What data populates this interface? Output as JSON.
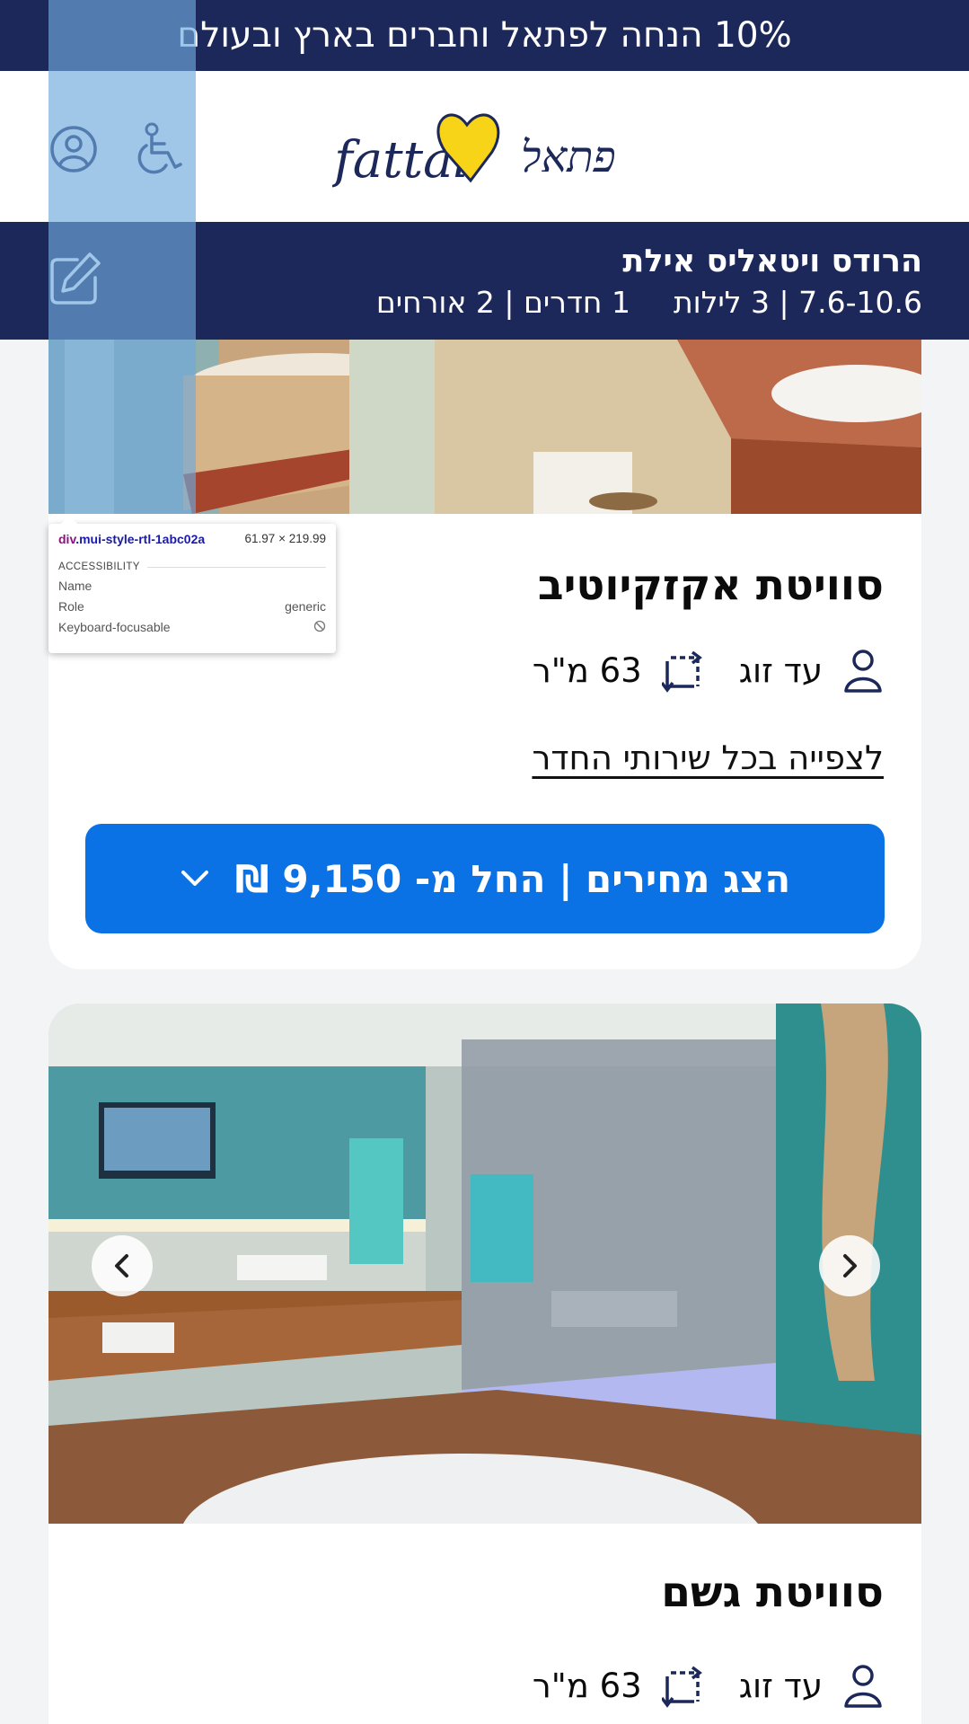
{
  "promo": {
    "text": "10% הנחה לפתאל וחברים בארץ ובעולם"
  },
  "header": {
    "logo_text_latin": "fattal",
    "logo_text_hebrew": "פתאל"
  },
  "search": {
    "hotel_name": "הרודס ויטאליס אילת",
    "dates_nights": "7.6-10.6 | 3 לילות",
    "rooms_guests": "1 חדרים | 2 אורחים"
  },
  "rooms": [
    {
      "title": "סוויטת אקזקיוטיב",
      "occupancy": "עד זוג",
      "size": "63 מ\"ר",
      "services_link": "לצפייה בכל שירותי החדר",
      "price_button": "הצג מחירים | החל מ- 9,150 ₪"
    },
    {
      "title": "סוויטת גשם",
      "occupancy": "עד זוג",
      "size": "63 מ\"ר"
    }
  ],
  "devtools": {
    "selector_tag": "div",
    "selector_class": ".mui-style-rtl-1abc02a",
    "size": "61.97 × 219.99",
    "section": "ACCESSIBILITY",
    "rows": [
      {
        "label": "Name",
        "value": ""
      },
      {
        "label": "Role",
        "value": "generic"
      },
      {
        "label": "Keyboard-focusable",
        "value": ""
      }
    ]
  },
  "colors": {
    "navy": "#1c2859",
    "primary_button": "#0a72e4",
    "heart": "#f7d417",
    "overlay": "#6fa8dc"
  }
}
